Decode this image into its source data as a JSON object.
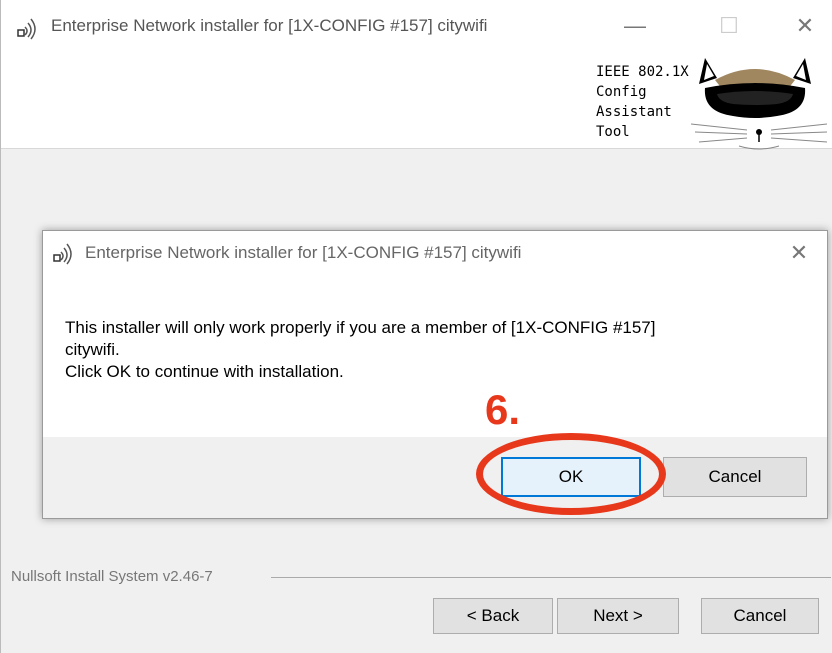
{
  "window": {
    "title": "Enterprise Network installer for [1X-CONFIG #157] citywifi",
    "controls": {
      "minimize": "—",
      "maximize": "☐",
      "close": "✕"
    },
    "icon": "wifi-signal-icon"
  },
  "branding": {
    "lines": [
      "IEEE 802.1X",
      "Config",
      "Assistant",
      "Tool"
    ],
    "logo": "cat-logo-icon"
  },
  "footer": {
    "system_label": "Nullsoft Install System v2.46-7",
    "back_label": "< Back",
    "next_label": "Next >",
    "cancel_label": "Cancel"
  },
  "dialog": {
    "title": "Enterprise Network installer for [1X-CONFIG #157] citywifi",
    "close": "✕",
    "message_lines": [
      "This installer will only work properly if you are a member of [1X-CONFIG #157]",
      "citywifi.",
      "Click OK to continue with installation."
    ],
    "ok_label": "OK",
    "cancel_label": "Cancel"
  },
  "annotation": {
    "step_label": "6.",
    "color": "#e8381c"
  }
}
